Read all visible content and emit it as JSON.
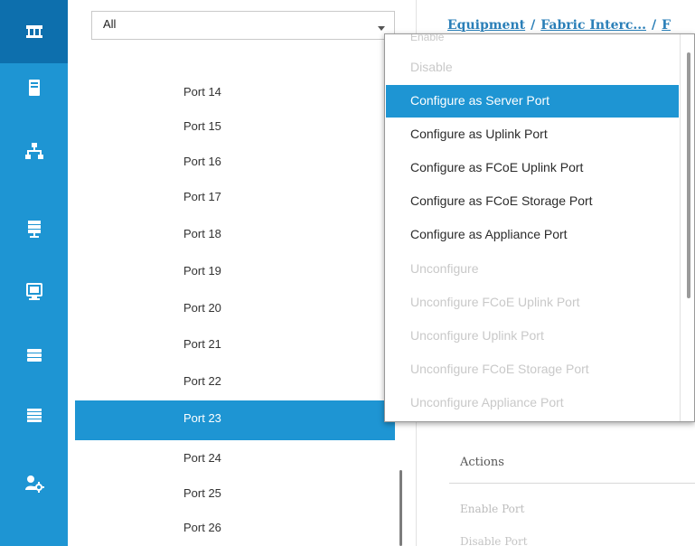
{
  "colors": {
    "rail": "#1e95d3",
    "rail_active": "#0d6fad",
    "selection": "#1e95d3",
    "link": "#2a7fb8",
    "disabled_text": "#c9c9c9"
  },
  "rail": {
    "items": [
      {
        "icon": "equipment-icon",
        "active": true
      },
      {
        "icon": "servers-icon",
        "active": false
      },
      {
        "icon": "lan-icon",
        "active": false
      },
      {
        "icon": "san-icon",
        "active": false
      },
      {
        "icon": "vm-icon",
        "active": false
      },
      {
        "icon": "storage-icon",
        "active": false
      },
      {
        "icon": "chassis-icon",
        "active": false
      },
      {
        "icon": "admin-icon",
        "active": false
      }
    ]
  },
  "filter": {
    "value": "All"
  },
  "ports": [
    {
      "label": "Port 14",
      "selected": false
    },
    {
      "label": "Port 15",
      "selected": false
    },
    {
      "label": "Port 16",
      "selected": false
    },
    {
      "label": "Port 17",
      "selected": false
    },
    {
      "label": "Port 18",
      "selected": false
    },
    {
      "label": "Port 19",
      "selected": false
    },
    {
      "label": "Port 20",
      "selected": false
    },
    {
      "label": "Port 21",
      "selected": false
    },
    {
      "label": "Port 22",
      "selected": false
    },
    {
      "label": "Port 23",
      "selected": true
    },
    {
      "label": "Port 24",
      "selected": false
    },
    {
      "label": "Port 25",
      "selected": false
    },
    {
      "label": "Port 26",
      "selected": false
    }
  ],
  "breadcrumb": {
    "items": [
      "Equipment",
      "Fabric Interc...",
      "F"
    ],
    "separator": "/"
  },
  "context_menu": {
    "partial_top_item": "Enable",
    "items": [
      {
        "label": "Disable",
        "state": "disabled"
      },
      {
        "label": "Configure as Server Port",
        "state": "highlight"
      },
      {
        "label": "Configure as Uplink Port",
        "state": "enabled"
      },
      {
        "label": "Configure as FCoE Uplink Port",
        "state": "enabled"
      },
      {
        "label": "Configure as FCoE Storage Port",
        "state": "enabled"
      },
      {
        "label": "Configure as Appliance Port",
        "state": "enabled"
      },
      {
        "label": "Unconfigure",
        "state": "disabled"
      },
      {
        "label": "Unconfigure FCoE Uplink Port",
        "state": "disabled"
      },
      {
        "label": "Unconfigure Uplink Port",
        "state": "disabled"
      },
      {
        "label": "Unconfigure FCoE Storage Port",
        "state": "disabled"
      },
      {
        "label": "Unconfigure Appliance Port",
        "state": "disabled"
      }
    ]
  },
  "actions": {
    "title": "Actions",
    "enable_port": "Enable Port",
    "disable_port": "Disable Port"
  }
}
